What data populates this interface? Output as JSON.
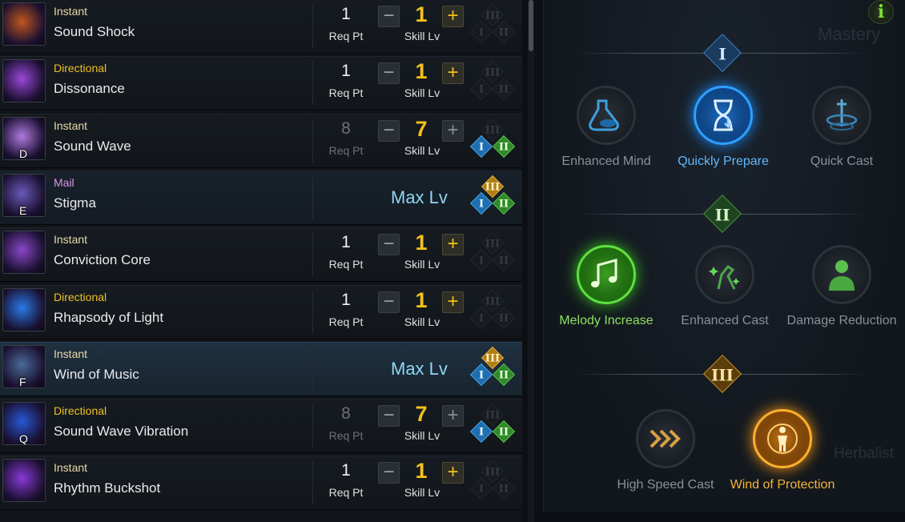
{
  "skills": [
    {
      "type": "Instant",
      "type_class": "t-instant",
      "name": "Sound Shock",
      "hotkey": "",
      "req_pt": "1",
      "req_label": "Req Pt",
      "skill_lv": "1",
      "lv_label": "Skill Lv",
      "state": "normal",
      "tripods": [
        0,
        0,
        0
      ],
      "icon_color": "#c0561e"
    },
    {
      "type": "Directional",
      "type_class": "t-directional",
      "name": "Dissonance",
      "hotkey": "",
      "req_pt": "1",
      "req_label": "Req Pt",
      "skill_lv": "1",
      "lv_label": "Skill Lv",
      "state": "normal",
      "tripods": [
        0,
        0,
        0
      ],
      "icon_color": "#9a48d8"
    },
    {
      "type": "Instant",
      "type_class": "t-instant",
      "name": "Sound Wave",
      "hotkey": "D",
      "req_pt": "8",
      "req_label": "Req Pt",
      "skill_lv": "7",
      "lv_label": "Skill Lv",
      "state": "dim",
      "tripods": [
        1,
        1,
        0
      ],
      "icon_color": "#b07ae0"
    },
    {
      "type": "Mail",
      "type_class": "t-mail",
      "name": "Stigma",
      "hotkey": "E",
      "max_label": "Max Lv",
      "state": "max",
      "tripods": [
        1,
        1,
        1
      ],
      "icon_color": "#6a5ab8"
    },
    {
      "type": "Instant",
      "type_class": "t-instant",
      "name": "Conviction Core",
      "hotkey": "",
      "req_pt": "1",
      "req_label": "Req Pt",
      "skill_lv": "1",
      "lv_label": "Skill Lv",
      "state": "normal",
      "tripods": [
        0,
        0,
        0
      ],
      "icon_color": "#8a48c8"
    },
    {
      "type": "Directional",
      "type_class": "t-directional",
      "name": "Rhapsody of Light",
      "hotkey": "",
      "req_pt": "1",
      "req_label": "Req Pt",
      "skill_lv": "1",
      "lv_label": "Skill Lv",
      "state": "normal",
      "tripods": [
        0,
        0,
        0
      ],
      "icon_color": "#2a7ae8"
    },
    {
      "type": "Instant",
      "type_class": "t-instant",
      "name": "Wind of Music",
      "hotkey": "F",
      "max_label": "Max Lv",
      "state": "max-selected",
      "tripods": [
        1,
        1,
        1
      ],
      "icon_color": "#4a6a98"
    },
    {
      "type": "Directional",
      "type_class": "t-directional",
      "name": "Sound Wave Vibration",
      "hotkey": "Q",
      "req_pt": "8",
      "req_label": "Req Pt",
      "skill_lv": "7",
      "lv_label": "Skill Lv",
      "state": "dim",
      "tripods": [
        1,
        1,
        0
      ],
      "icon_color": "#2a58d8"
    },
    {
      "type": "Instant",
      "type_class": "t-instant",
      "name": "Rhythm Buckshot",
      "hotkey": "",
      "req_pt": "1",
      "req_label": "Req Pt",
      "skill_lv": "1",
      "lv_label": "Skill Lv",
      "state": "normal",
      "tripods": [
        0,
        0,
        0
      ],
      "icon_color": "#8a3ad8"
    }
  ],
  "buttons": {
    "minus": "−",
    "plus": "+"
  },
  "tripod_labels": {
    "t1": "I",
    "t2": "II",
    "t3": "III"
  },
  "mastery": {
    "ghost_title": "Mastery",
    "ghost_herbalist": "Herbalist",
    "info_label": "i",
    "tiers": [
      {
        "label": "I",
        "nodes": [
          {
            "label": "Enhanced Mind",
            "icon": "flask-icon",
            "selected": false
          },
          {
            "label": "Quickly Prepare",
            "icon": "hourglass-icon",
            "selected": true
          },
          {
            "label": "Quick Cast",
            "icon": "sword-spin-icon",
            "selected": false
          }
        ]
      },
      {
        "label": "II",
        "nodes": [
          {
            "label": "Melody Increase",
            "icon": "music-notes-icon",
            "selected": true
          },
          {
            "label": "Enhanced Cast",
            "icon": "sparkle-hand-icon",
            "selected": false
          },
          {
            "label": "Damage Reduction",
            "icon": "person-shield-icon",
            "selected": false
          }
        ]
      },
      {
        "label": "III",
        "nodes": [
          {
            "label": "High Speed Cast",
            "icon": "chevrons-icon",
            "selected": false
          },
          {
            "label": "Wind of Protection",
            "icon": "protected-figure-icon",
            "selected": true
          }
        ]
      }
    ]
  },
  "colors": {
    "gold": "#f5c21a",
    "max_blue": "#8ed6f5",
    "tier1": "#2fa0ff",
    "tier2": "#5ee040",
    "tier3": "#ffb030"
  }
}
